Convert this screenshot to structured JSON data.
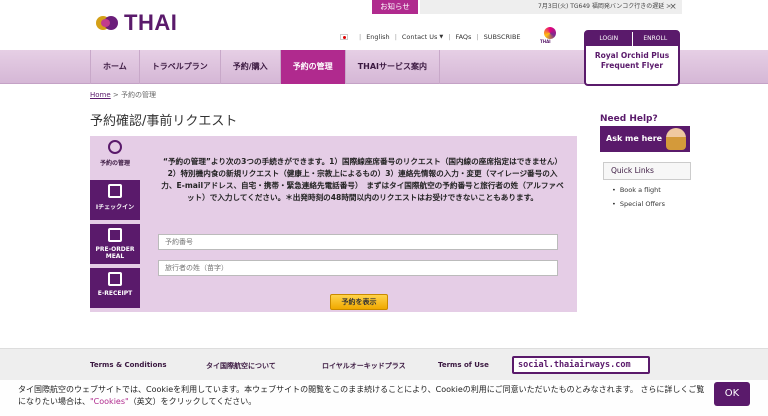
{
  "header": {
    "logo_text": "THAI",
    "notice_label": "お知らせ",
    "ticker_text": "7月3日(火) TG649 福岡発バンコク行きの遅延 >",
    "ticker_close": "×",
    "util_links": {
      "english": "English",
      "contact": "Contact Us",
      "faqs": "FAQs",
      "subscribe": "SUBSCRIBE"
    },
    "star_alliance_label": "THAI",
    "login": {
      "login_label": "LOGIN",
      "enroll_label": "ENROLL",
      "program_line1": "Royal Orchid Plus",
      "program_line2": "Frequent Flyer"
    }
  },
  "nav": {
    "items": [
      {
        "label": "ホーム"
      },
      {
        "label": "トラベルプラン"
      },
      {
        "label": "予約/購入"
      },
      {
        "label": "予約の管理"
      },
      {
        "label": "THAIサービス案内"
      }
    ]
  },
  "breadcrumb": {
    "home": "Home",
    "separator": ">",
    "current": "予約の管理"
  },
  "page_title": "予約確認/事前リクエスト",
  "side_tabs": [
    {
      "label": "予約の管理"
    },
    {
      "label": "Iチェックイン"
    },
    {
      "label": "PRE-ORDER MEAL"
    },
    {
      "label": "E-RECEIPT"
    }
  ],
  "panel": {
    "description": "“予約の管理”より次の3つの手続きができます。1）国際線座席番号のリクエスト（国内線の座席指定はできません）2）特別機内食の新規リクエスト（健康上・宗教上によるもの）3）連絡先情報の入力・変更（マイレージ番号の入力、E-mailアドレス、自宅・携帯・緊急連絡先電話番号）　まずはタイ国際航空の予約番号と旅行者の姓（アルファベット）で入力してください。＊出発時刻の48時間以内のリクエストはお受けできないこともあります。",
    "booking_placeholder": "予約番号",
    "surname_placeholder": "旅行者の姓（苗字）",
    "submit_label": "予約を表示"
  },
  "help": {
    "need_help": "Need Help?",
    "ask_me": "Ask me here",
    "quick_links_title": "Quick Links",
    "quick_links": [
      {
        "label": "Book a flight"
      },
      {
        "label": "Special Offers"
      }
    ]
  },
  "footer": {
    "col1": "Terms & Conditions",
    "col2": "タイ国際航空について",
    "col3": "ロイヤルオーキッドプラス",
    "col4": "Terms of Use",
    "social": "social.thaiairways.com"
  },
  "cookie": {
    "text_before": "タイ国際航空のウェブサイトでは、Cookieを利用しています。本ウェブサイトの閲覧をこのまま続けることにより、Cookieの利用にご同意いただいたものとみなされます。 さらに詳しくご覧になりたい場合は、",
    "link": "\"Cookies\"",
    "text_after": "（英文）をクリックしてください。",
    "ok_label": "OK"
  }
}
